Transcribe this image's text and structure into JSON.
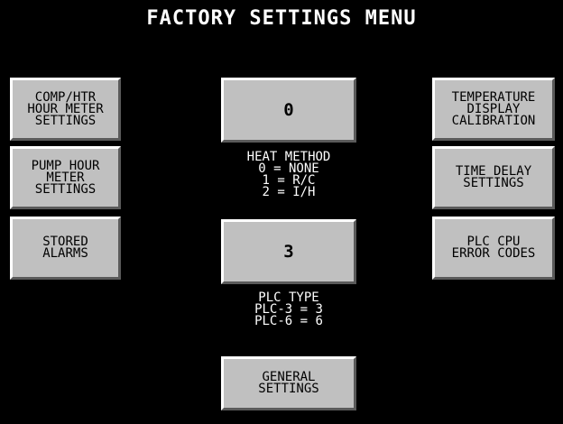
{
  "title": "FACTORY SETTINGS MENU",
  "left_buttons": [
    {
      "label": "COMP/HTR\nHOUR METER\nSETTINGS"
    },
    {
      "label": "PUMP HOUR\nMETER\nSETTINGS"
    },
    {
      "label": "STORED\nALARMS"
    }
  ],
  "right_buttons": [
    {
      "label": "TEMPERATURE\nDISPLAY\nCALIBRATION"
    },
    {
      "label": "TIME DELAY\nSETTINGS"
    },
    {
      "label": "PLC CPU\nERROR CODES"
    }
  ],
  "heat_method": {
    "value": "0",
    "caption_lines": [
      "HEAT METHOD",
      "0 = NONE",
      "1 = R/C",
      "2 = I/H"
    ]
  },
  "plc_type": {
    "value": "3",
    "caption_lines": [
      "PLC TYPE",
      "PLC-3 = 3",
      "PLC-6 = 6"
    ]
  },
  "general_settings": {
    "label": "GENERAL\nSETTINGS"
  },
  "colors": {
    "background": "#000000",
    "button_face": "#c0c0c0",
    "text_on_background": "#ffffff"
  }
}
